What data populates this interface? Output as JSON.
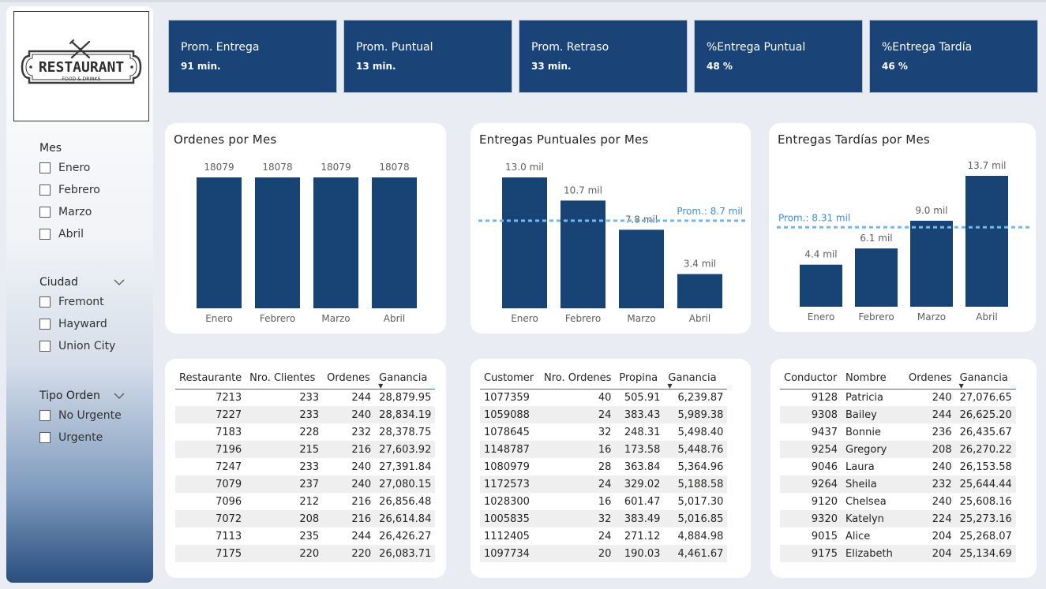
{
  "logo": {
    "main": "RESTAURANT",
    "sub": "FOOD & DRINKS"
  },
  "slicers": [
    {
      "title": "Mes",
      "has_chevron": false,
      "items": [
        "Enero",
        "Febrero",
        "Marzo",
        "Abril"
      ]
    },
    {
      "title": "Ciudad",
      "has_chevron": true,
      "items": [
        "Fremont",
        "Hayward",
        "Union City"
      ]
    },
    {
      "title": "Tipo Orden",
      "has_chevron": true,
      "items": [
        "No Urgente",
        "Urgente"
      ]
    }
  ],
  "kpis": [
    {
      "label": "Prom. Entrega",
      "value": "91 min."
    },
    {
      "label": "Prom. Puntual",
      "value": "13 min."
    },
    {
      "label": "Prom. Retraso",
      "value": "33 min."
    },
    {
      "label": "%Entrega Puntual",
      "value": "48 %"
    },
    {
      "label": "%Entrega Tardía",
      "value": "46 %"
    }
  ],
  "colors": {
    "bar": "#174475",
    "avg_line": "#74b7ec",
    "avg_text": "#3e8fd6",
    "kpi_bg": "#1a4477"
  },
  "chart_data": [
    {
      "type": "bar",
      "title": "Ordenes por Mes",
      "categories": [
        "Enero",
        "Febrero",
        "Marzo",
        "Abril"
      ],
      "values": [
        18079,
        18078,
        18079,
        18078
      ],
      "labels": [
        "18079",
        "18078",
        "18079",
        "18078"
      ],
      "ylim": [
        0,
        18079
      ]
    },
    {
      "type": "bar",
      "title": "Entregas Puntuales por Mes",
      "categories": [
        "Enero",
        "Febrero",
        "Marzo",
        "Abril"
      ],
      "values": [
        13000,
        10700,
        7800,
        3400
      ],
      "labels": [
        "13.0 mil",
        "10.7 mil",
        "7.8 mil",
        "3.4 mil"
      ],
      "average": {
        "value": 8700,
        "label": "Prom.: 8.7 mil"
      },
      "ylim": [
        0,
        13000
      ]
    },
    {
      "type": "bar",
      "title": "Entregas Tardías por Mes",
      "categories": [
        "Enero",
        "Febrero",
        "Marzo",
        "Abril"
      ],
      "values": [
        4400,
        6100,
        9000,
        13700
      ],
      "labels": [
        "4.4 mil",
        "6.1 mil",
        "9.0 mil",
        "13.7 mil"
      ],
      "average": {
        "value": 8310,
        "label": "Prom.: 8.31 mil"
      },
      "ylim": [
        0,
        13700
      ]
    }
  ],
  "tables": [
    {
      "headers": [
        "Restaurante",
        "Nro. Clientes",
        "Ordenes",
        "Ganancia"
      ],
      "sorted_col": 3,
      "rows": [
        [
          "7213",
          "233",
          "244",
          "28,879.95"
        ],
        [
          "7227",
          "233",
          "240",
          "28,834.19"
        ],
        [
          "7183",
          "228",
          "232",
          "28,378.75"
        ],
        [
          "7196",
          "215",
          "216",
          "27,603.92"
        ],
        [
          "7247",
          "233",
          "240",
          "27,391.84"
        ],
        [
          "7079",
          "237",
          "240",
          "27,080.15"
        ],
        [
          "7096",
          "212",
          "216",
          "26,856.48"
        ],
        [
          "7072",
          "208",
          "216",
          "26,614.84"
        ],
        [
          "7113",
          "235",
          "244",
          "26,426.27"
        ],
        [
          "7175",
          "220",
          "220",
          "26,083.71"
        ]
      ]
    },
    {
      "headers": [
        "Customer",
        "Nro. Ordenes",
        "Propina",
        "Ganancia"
      ],
      "sorted_col": 3,
      "rows": [
        [
          "1077359",
          "40",
          "505.91",
          "6,239.87"
        ],
        [
          "1059088",
          "24",
          "383.43",
          "5,989.38"
        ],
        [
          "1078645",
          "32",
          "248.31",
          "5,498.40"
        ],
        [
          "1148787",
          "16",
          "173.58",
          "5,448.76"
        ],
        [
          "1080979",
          "28",
          "363.84",
          "5,364.96"
        ],
        [
          "1172573",
          "24",
          "329.02",
          "5,188.58"
        ],
        [
          "1028300",
          "16",
          "601.47",
          "5,017.30"
        ],
        [
          "1005835",
          "32",
          "383.49",
          "5,016.85"
        ],
        [
          "1112405",
          "24",
          "271.12",
          "4,884.98"
        ],
        [
          "1097734",
          "20",
          "190.03",
          "4,461.67"
        ]
      ]
    },
    {
      "headers": [
        "Conductor",
        "Nombre",
        "Ordenes",
        "Ganancia"
      ],
      "sorted_col": 3,
      "rows": [
        [
          "9128",
          "Patricia",
          "240",
          "27,076.65"
        ],
        [
          "9308",
          "Bailey",
          "244",
          "26,625.20"
        ],
        [
          "9437",
          "Bonnie",
          "236",
          "26,435.67"
        ],
        [
          "9254",
          "Gregory",
          "208",
          "26,270.22"
        ],
        [
          "9046",
          "Laura",
          "240",
          "26,153.58"
        ],
        [
          "9264",
          "Sheila",
          "232",
          "25,644.44"
        ],
        [
          "9120",
          "Chelsea",
          "240",
          "25,608.16"
        ],
        [
          "9320",
          "Katelyn",
          "224",
          "25,273.16"
        ],
        [
          "9015",
          "Alice",
          "204",
          "25,268.07"
        ],
        [
          "9175",
          "Elizabeth",
          "204",
          "25,134.69"
        ]
      ]
    }
  ]
}
